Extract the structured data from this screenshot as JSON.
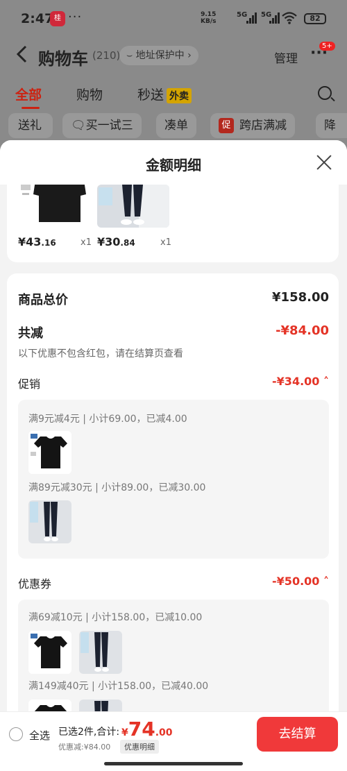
{
  "status": {
    "time": "2:47",
    "app_icon": "桂",
    "dots": "···",
    "speed_value": "9.15",
    "speed_unit": "KB/s",
    "net1": "5G",
    "net2": "5G",
    "battery": "82"
  },
  "header": {
    "title": "购物车",
    "count": "(210)",
    "address": "地址保护中",
    "manage": "管理",
    "badge": "5+"
  },
  "tabs": {
    "all": "全部",
    "shopping": "购物",
    "instant": "秒送",
    "waimai": "外卖"
  },
  "chips": {
    "gift": "送礼",
    "trial": "买一试三",
    "combine": "凑单",
    "cu_icon": "促",
    "cross_store": "跨店满减",
    "more": "降"
  },
  "sheet": {
    "title": "金额明细",
    "products": [
      {
        "price_int": "¥43",
        "price_dec": ".16",
        "qty": "x1"
      },
      {
        "price_int": "¥30",
        "price_dec": ".84",
        "qty": "x1"
      }
    ],
    "total_label": "商品总价",
    "total_value": "¥158.00",
    "reduce_label": "共减",
    "reduce_value": "-¥84.00",
    "note": "以下优惠不包含红包，请在结算页查看",
    "promo": {
      "label": "促销",
      "value": "-¥34.00",
      "rules": [
        "满9元减4元 | 小计69.00，已减4.00",
        "满89元减30元 | 小计89.00，已减30.00"
      ]
    },
    "coupon": {
      "label": "优惠券",
      "value": "-¥50.00",
      "rules": [
        "满69减10元 | 小计158.00，已减10.00",
        "满149减40元 | 小计158.00，已减40.00"
      ]
    }
  },
  "bottom": {
    "select_all": "全选",
    "selected": "已选2件,合计:",
    "yen": "¥",
    "total_int": "74",
    "total_dec": ".00",
    "discount": "优惠减:¥84.00",
    "detail_btn": "优惠明细",
    "checkout": "去结算"
  },
  "colors": {
    "accent": "#e43326",
    "checkout_bg": "#f0393a"
  }
}
